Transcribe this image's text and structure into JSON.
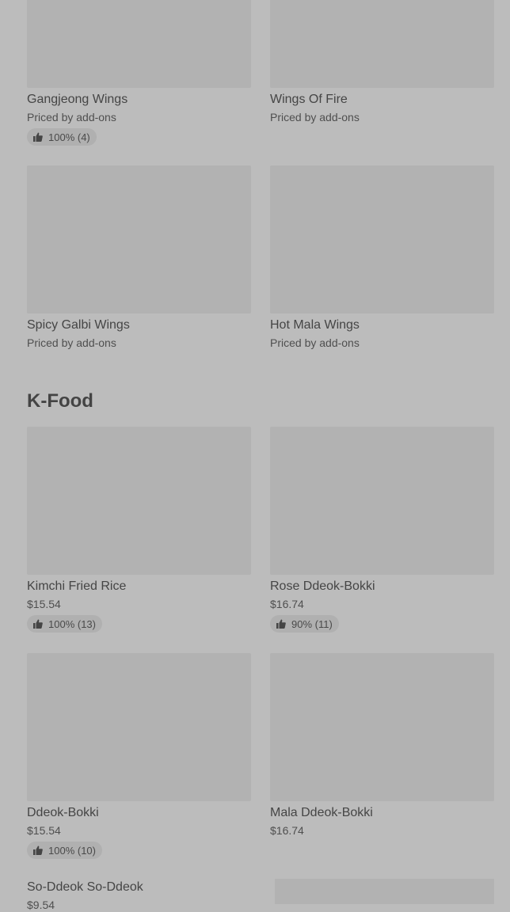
{
  "sections": [
    {
      "items": [
        {
          "name": "Gangjeong Wings",
          "price": "Priced by add-ons",
          "rating": "100% (4)"
        },
        {
          "name": "Wings Of Fire",
          "price": "Priced by add-ons",
          "rating": null
        },
        {
          "name": "Spicy Galbi Wings",
          "price": "Priced by add-ons",
          "rating": null
        },
        {
          "name": "Hot Mala Wings",
          "price": "Priced by add-ons",
          "rating": null
        }
      ]
    },
    {
      "title": "K-Food",
      "items": [
        {
          "name": "Kimchi Fried Rice",
          "price": "$15.54",
          "rating": "100% (13)"
        },
        {
          "name": "Rose Ddeok-Bokki",
          "price": "$16.74",
          "rating": "90% (11)"
        },
        {
          "name": "Ddeok-Bokki",
          "price": "$15.54",
          "rating": "100% (10)"
        },
        {
          "name": "Mala Ddeok-Bokki",
          "price": "$16.74",
          "rating": null
        },
        {
          "name": "So-Ddeok So-Ddeok",
          "price": "$9.54",
          "rating": null
        }
      ]
    }
  ],
  "icons": {
    "rating": "thumbs-up-icon"
  }
}
